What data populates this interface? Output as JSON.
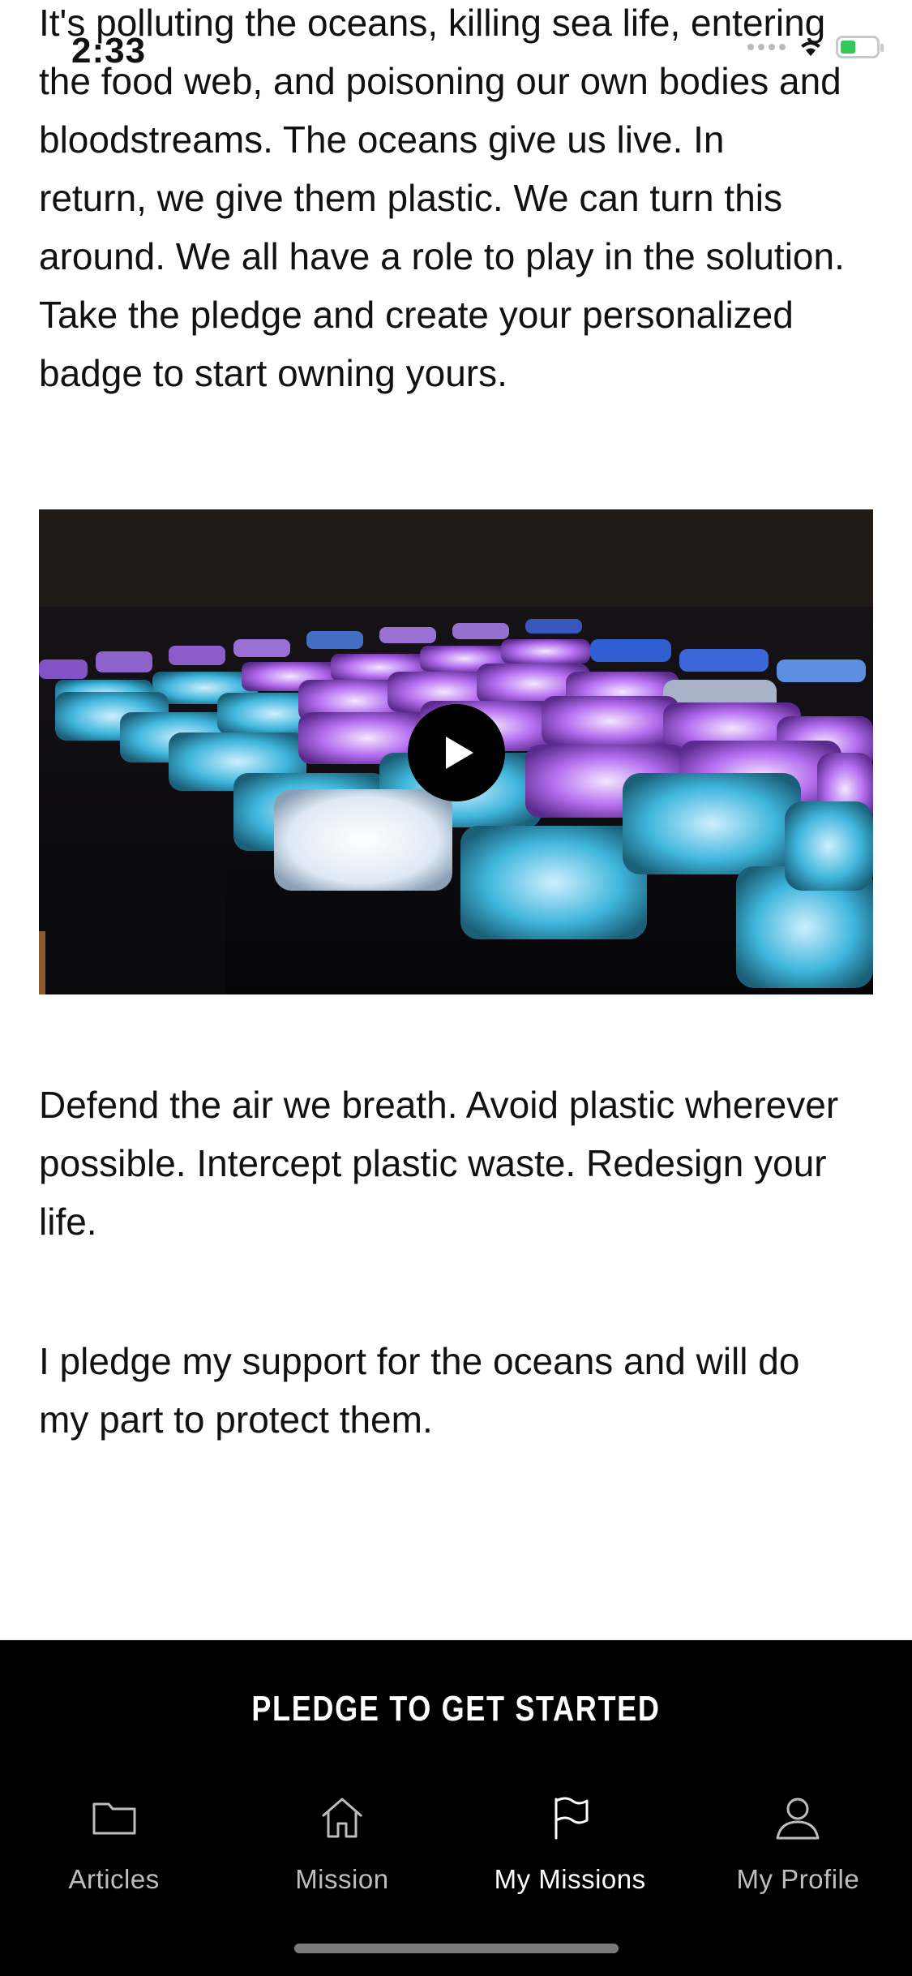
{
  "status_bar": {
    "time": "2:33"
  },
  "article": {
    "intro_paragraph": "It's polluting the oceans, killing sea life, entering\nthe food web, and poisoning our own bodies and\nbloodstreams. The oceans give us live.  In\nreturn, we give them plastic. We can turn this\naround. We all have a role to play in the solution.\nTake the pledge and create your personalized\nbadge to start owning yours.",
    "paragraph_two": "Defend the air we breath. Avoid plastic wherever\npossible. Intercept plastic waste. Redesign your\nlife.",
    "paragraph_three": "I pledge my support for the oceans and will do\nmy part to protect them."
  },
  "video": {
    "play_icon": "play-icon"
  },
  "pledge_button": {
    "label": "PLEDGE TO GET STARTED"
  },
  "tab_bar": {
    "tabs": [
      {
        "label": "Articles",
        "icon": "folder-icon",
        "active": false
      },
      {
        "label": "Mission",
        "icon": "home-icon",
        "active": false
      },
      {
        "label": "My Missions",
        "icon": "flag-icon",
        "active": true
      },
      {
        "label": "My Profile",
        "icon": "user-icon",
        "active": false
      }
    ]
  },
  "colors": {
    "background": "#ffffff",
    "bar": "#000000",
    "accent_active": "#ffffff",
    "inactive": "#bdbdbd"
  }
}
